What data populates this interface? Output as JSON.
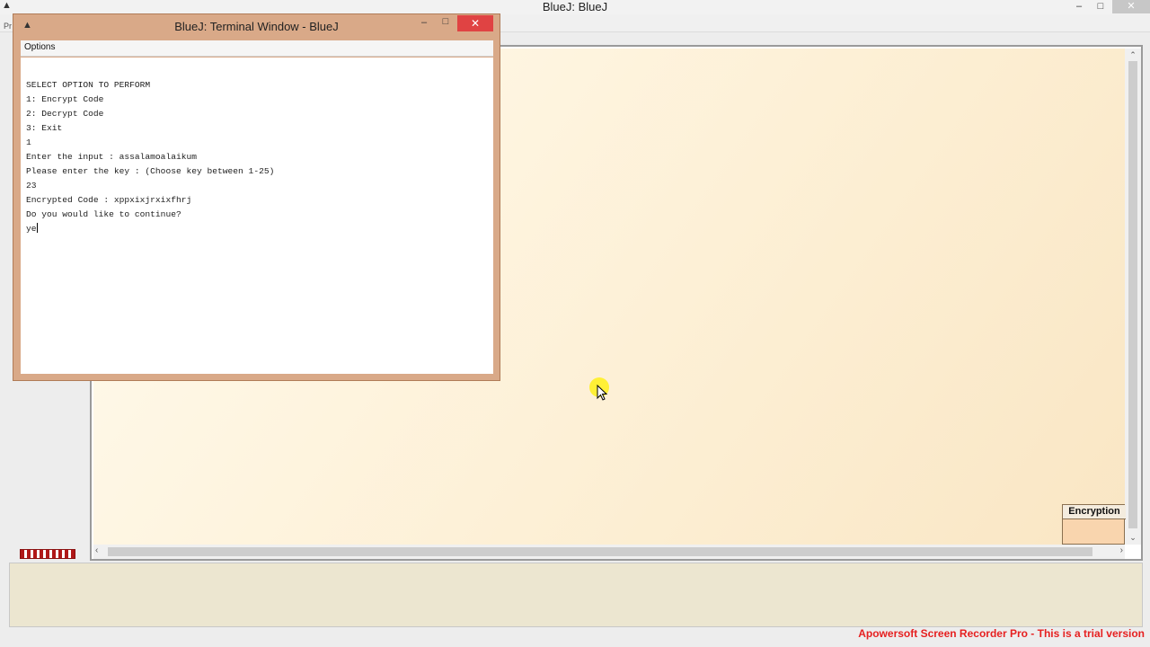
{
  "main_window": {
    "title": "BlueJ:  BlueJ",
    "menu_fragment": "Pr",
    "class_box": {
      "name": "Encryption"
    }
  },
  "terminal": {
    "title": "BlueJ: Terminal Window - BlueJ",
    "menu": {
      "options_label": "Options"
    },
    "lines": [
      "SELECT OPTION TO PERFORM",
      "1: Encrypt Code",
      "2: Decrypt Code",
      "3: Exit",
      "1",
      "Enter the input : assalamoalaikum",
      "Please enter the key : (Choose key between 1-25)",
      "23",
      "Encrypted Code : xppxixjrxixfhrj",
      "Do you would like to continue?"
    ],
    "current_input": "ye"
  },
  "watermark": {
    "text": "Apowersoft Screen Recorder Pro - This is a trial version"
  },
  "icons": {
    "app_icon": "bluej-icon",
    "window_controls": [
      "minimize-icon",
      "maximize-icon",
      "close-icon"
    ],
    "scroll_arrows": [
      "chevron-up-icon",
      "chevron-down-icon",
      "chevron-left-icon",
      "chevron-right-icon"
    ]
  },
  "colors": {
    "terminal_frame": "#d9a988",
    "close_button": "#e04343",
    "class_box_fill": "#f9d5ae",
    "watermark": "#e62020"
  }
}
